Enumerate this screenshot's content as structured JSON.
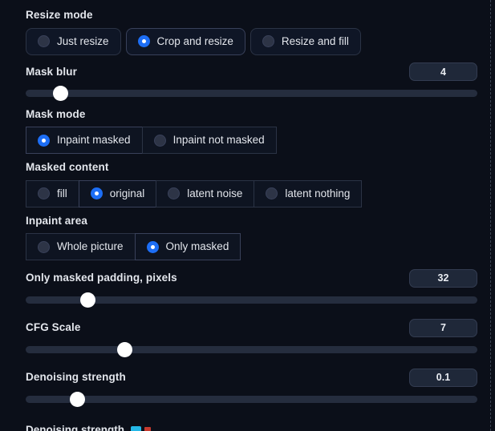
{
  "panel": {
    "name": "img2img-inpaint-settings"
  },
  "resize_mode": {
    "label": "Resize mode",
    "options": [
      {
        "label": "Just resize",
        "selected": false
      },
      {
        "label": "Crop and resize",
        "selected": true
      },
      {
        "label": "Resize and fill",
        "selected": false
      }
    ]
  },
  "mask_blur": {
    "label": "Mask blur",
    "value": "4",
    "handle_pct": 7.8
  },
  "mask_mode": {
    "label": "Mask mode",
    "options": [
      {
        "label": "Inpaint masked",
        "selected": true
      },
      {
        "label": "Inpaint not masked",
        "selected": false
      }
    ]
  },
  "masked_content": {
    "label": "Masked content",
    "options": [
      {
        "label": "fill",
        "selected": false
      },
      {
        "label": "original",
        "selected": true
      },
      {
        "label": "latent noise",
        "selected": false
      },
      {
        "label": "latent nothing",
        "selected": false
      }
    ]
  },
  "inpaint_area": {
    "label": "Inpaint area",
    "options": [
      {
        "label": "Whole picture",
        "selected": false
      },
      {
        "label": "Only masked",
        "selected": true
      }
    ]
  },
  "only_masked_padding": {
    "label": "Only masked padding, pixels",
    "value": "32",
    "handle_pct": 13.8
  },
  "cfg_scale": {
    "label": "CFG Scale",
    "value": "7",
    "handle_pct": 21.9
  },
  "denoising_strength": {
    "label": "Denoising strength",
    "value": "0.1",
    "handle_pct": 11.4
  },
  "clipped_bottom": {
    "label": "Denoising strength",
    "icons": [
      "cyan-square-icon",
      "red-square-icon"
    ]
  },
  "colors": {
    "background": "#0b0f19",
    "accent": "#1d6ef5",
    "track": "#252d3e",
    "handle": "#ffffff",
    "border": "#2b3345",
    "text": "#e3e6ec"
  }
}
